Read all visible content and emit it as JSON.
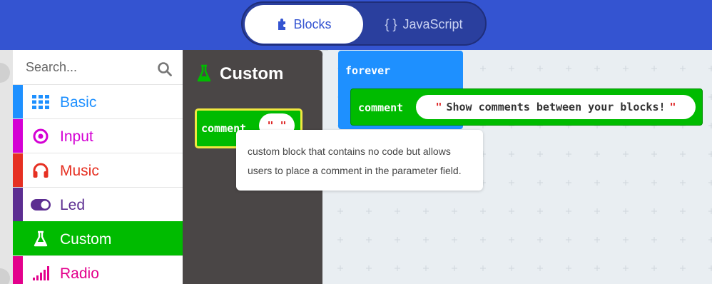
{
  "header": {
    "tabs": [
      {
        "label": "Blocks",
        "icon": "puzzle-icon",
        "active": true
      },
      {
        "label": "JavaScript",
        "icon": "braces-icon",
        "active": false
      }
    ],
    "braces_glyph": "{ }",
    "colors": {
      "header_bg": "#3454d1"
    }
  },
  "toolbox": {
    "search_placeholder": "Search...",
    "categories": [
      {
        "label": "Basic",
        "icon": "grid-icon",
        "color": "#1e90ff"
      },
      {
        "label": "Input",
        "icon": "target-icon",
        "color": "#d400d4"
      },
      {
        "label": "Music",
        "icon": "headphones-icon",
        "color": "#e63022"
      },
      {
        "label": "Led",
        "icon": "toggle-icon",
        "color": "#5c2d91"
      },
      {
        "label": "Custom",
        "icon": "flask-icon",
        "color": "#00bb00",
        "selected": true
      },
      {
        "label": "Radio",
        "icon": "signal-icon",
        "color": "#e3008c"
      }
    ]
  },
  "flyout": {
    "title": "Custom",
    "block": {
      "label": "comment",
      "value": "\" \""
    }
  },
  "workspace": {
    "forever_label": "forever",
    "comment_block": {
      "label": "comment",
      "quote_open": "\"",
      "value": "Show comments between your blocks!",
      "quote_close": "\""
    }
  },
  "tooltip": {
    "text": "custom block that contains no code but allows users to place a comment in the parameter field."
  }
}
